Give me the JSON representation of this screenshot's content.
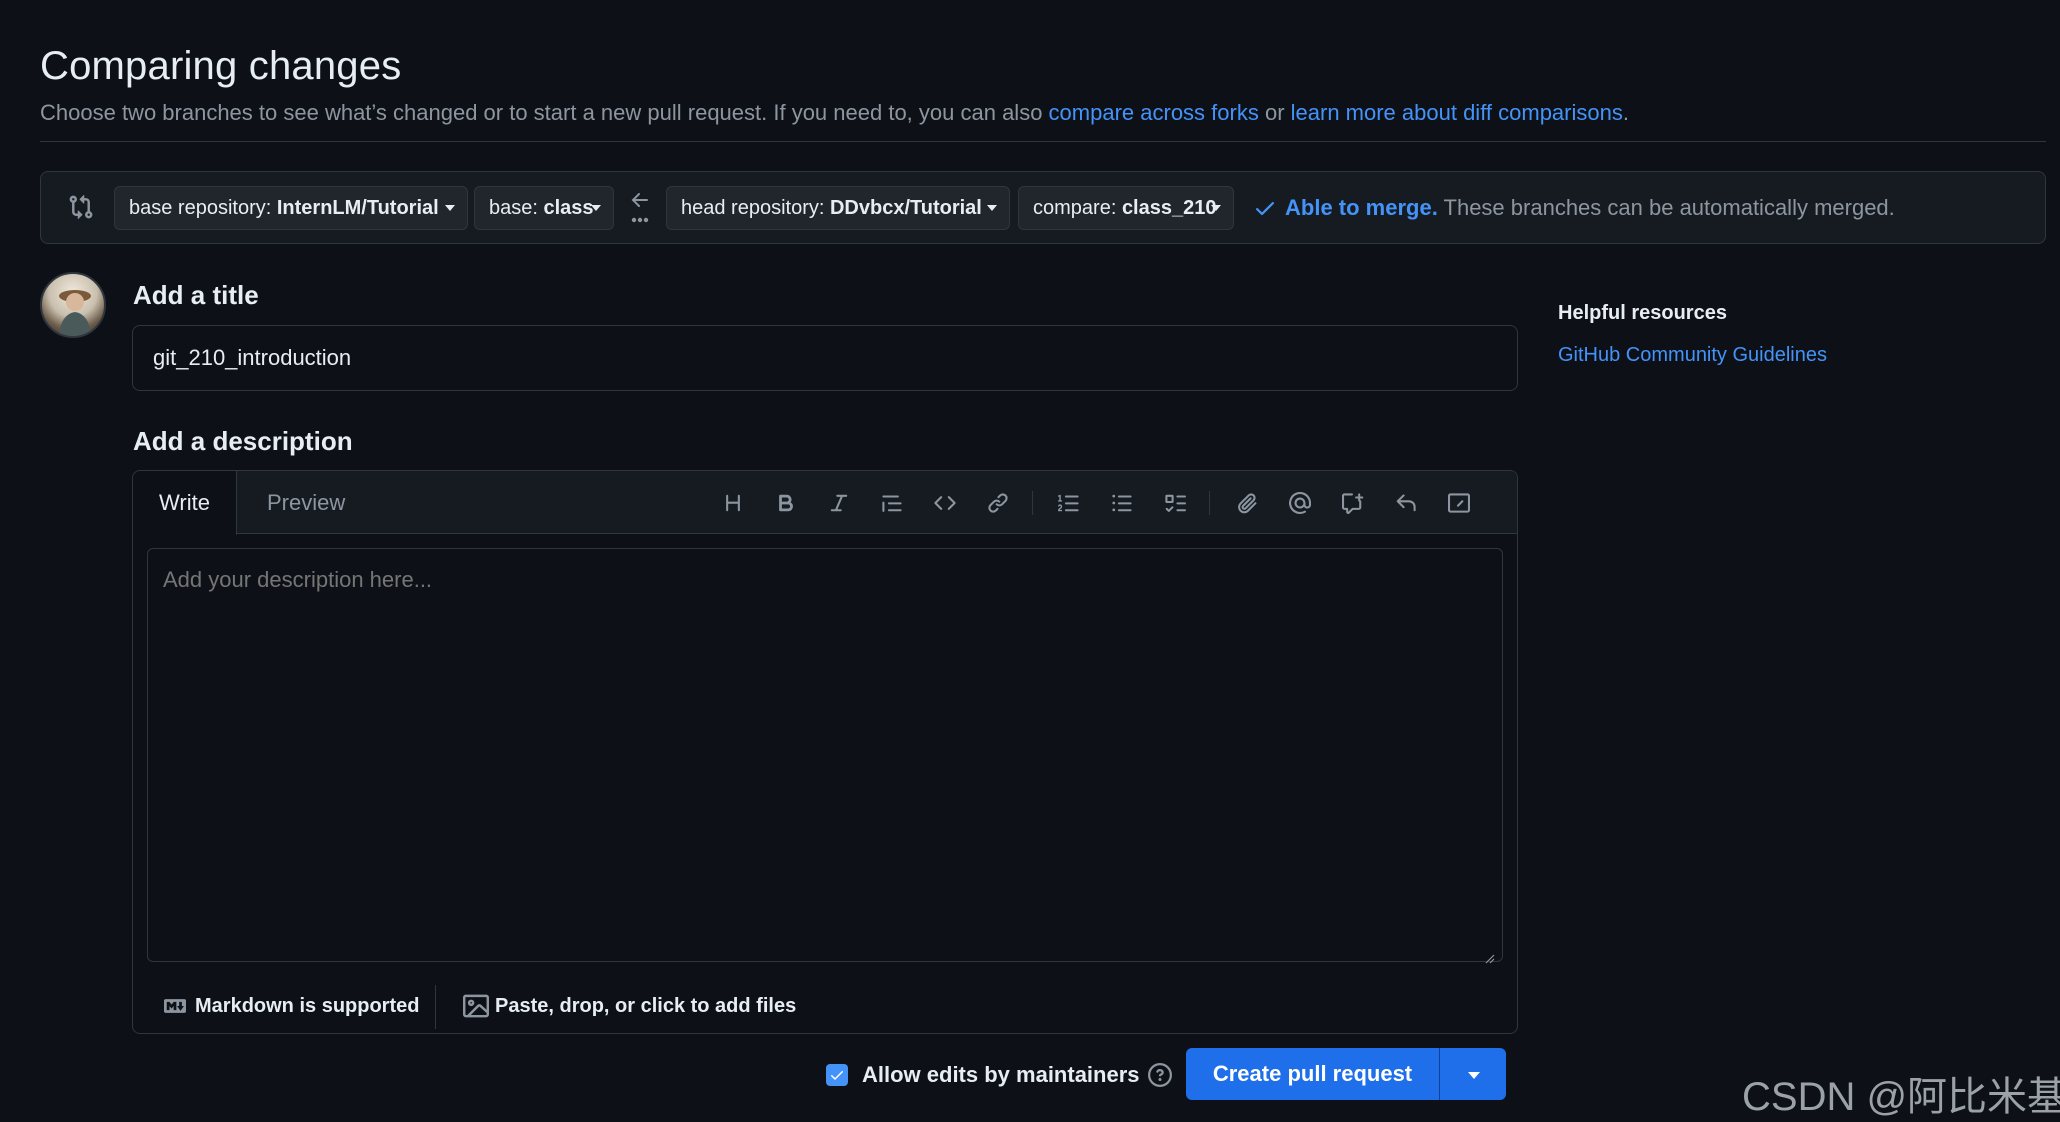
{
  "header": {
    "title": "Comparing changes",
    "subtitle_prefix": "Choose two branches to see what’s changed or to start a new pull request. If you need to, you can also ",
    "link_forks": "compare across forks",
    "subtitle_or": " or ",
    "link_learn": "learn more about diff comparisons",
    "subtitle_end": "."
  },
  "range": {
    "base_repo_label": "base repository: ",
    "base_repo_value": "InternLM/Tutorial",
    "base_label": "base: ",
    "base_value": "class",
    "head_repo_label": "head repository: ",
    "head_repo_value": "DDvbcx/Tutorial",
    "compare_label": "compare: ",
    "compare_value": "class_210",
    "merge_status": "Able to merge.",
    "merge_text": " These branches can be automatically merged."
  },
  "form": {
    "title_label": "Add a title",
    "title_value": "git_210_introduction",
    "description_label": "Add a description",
    "tabs": [
      "Write",
      "Preview"
    ],
    "description_placeholder": "Add your description here...",
    "markdown_note": "Markdown is supported",
    "files_note": "Paste, drop, or click to add files"
  },
  "toolbar_icons": [
    "heading-icon",
    "bold-icon",
    "italic-icon",
    "quote-icon",
    "code-icon",
    "link-icon",
    "ordered-list-icon",
    "unordered-list-icon",
    "task-list-icon",
    "attach-icon",
    "mention-icon",
    "reference-icon",
    "reply-icon",
    "slash-command-icon"
  ],
  "actions": {
    "allow_edits": "Allow edits by maintainers",
    "allow_edits_checked": true,
    "create_label": "Create pull request"
  },
  "sidebar": {
    "heading": "Helpful resources",
    "link": "GitHub Community Guidelines"
  },
  "watermark": "CSDN @阿比米基",
  "colors": {
    "background": "#0d1117",
    "accent": "#4493f8",
    "primary_button": "#1f6feb",
    "border": "#30363d"
  }
}
